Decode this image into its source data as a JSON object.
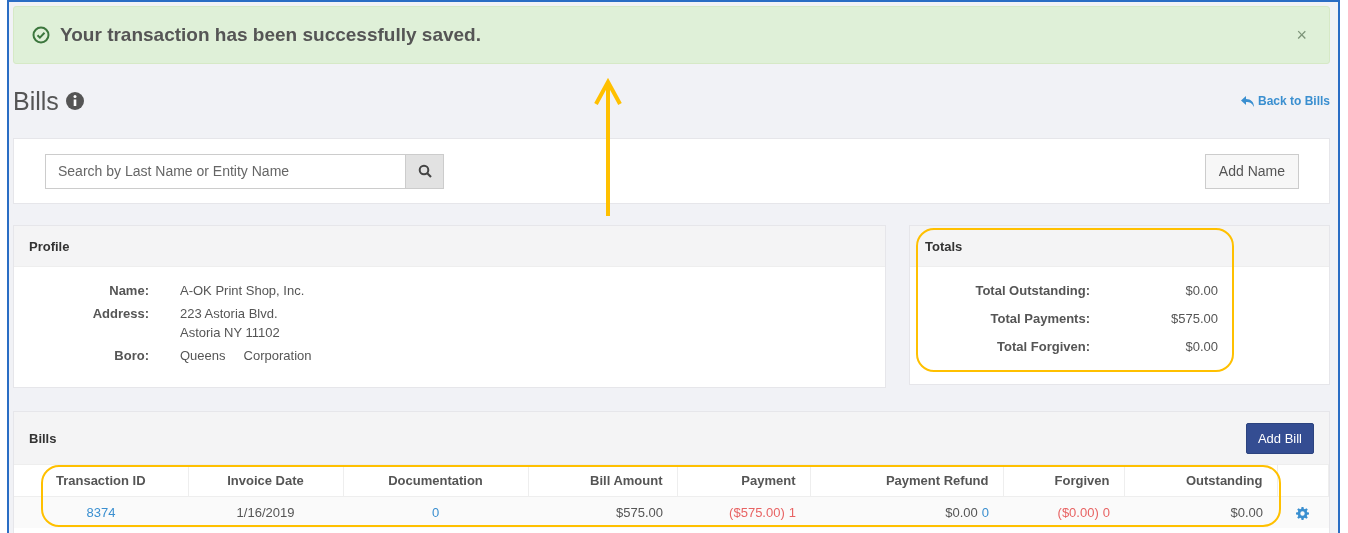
{
  "alert": {
    "message": "Your transaction has been successfully saved.",
    "close": "×"
  },
  "page": {
    "title": "Bills",
    "back_link": "Back to Bills"
  },
  "search": {
    "placeholder": "Search by Last Name or Entity Name",
    "add_button": "Add Name"
  },
  "profile": {
    "title": "Profile",
    "fields": [
      {
        "label": "Name:",
        "lines": [
          "A-OK Print Shop, Inc."
        ]
      },
      {
        "label": "Address:",
        "lines": [
          "223 Astoria Blvd.",
          "Astoria NY 11102"
        ]
      },
      {
        "label": "Boro:",
        "values": [
          "Queens",
          "Corporation"
        ]
      }
    ]
  },
  "totals": {
    "title": "Totals",
    "rows": [
      {
        "label": "Total Outstanding:",
        "value": "$0.00"
      },
      {
        "label": "Total Payments:",
        "value": "$575.00"
      },
      {
        "label": "Total Forgiven:",
        "value": "$0.00"
      }
    ]
  },
  "bills": {
    "title": "Bills",
    "add_button": "Add Bill",
    "columns": [
      "Transaction ID",
      "Invoice Date",
      "Documentation",
      "Bill Amount",
      "Payment",
      "Payment Refund",
      "Forgiven",
      "Outstanding"
    ],
    "rows": [
      {
        "cells": [
          {
            "text": "8374",
            "link": true
          },
          {
            "text": "1/16/2019",
            "link": false
          },
          {
            "text": "0",
            "link": true
          },
          {
            "text": "$575.00",
            "link": false
          },
          {
            "text": "($575.00)",
            "link": false,
            "negative": true,
            "count": "1",
            "count_negative": true
          },
          {
            "text": "$0.00",
            "link": false,
            "negative": false,
            "count": "0",
            "count_negative": false
          },
          {
            "text": "($0.00)",
            "link": false,
            "negative": true,
            "count": "0",
            "count_negative": true
          },
          {
            "text": "$0.00",
            "link": false
          }
        ]
      }
    ]
  }
}
